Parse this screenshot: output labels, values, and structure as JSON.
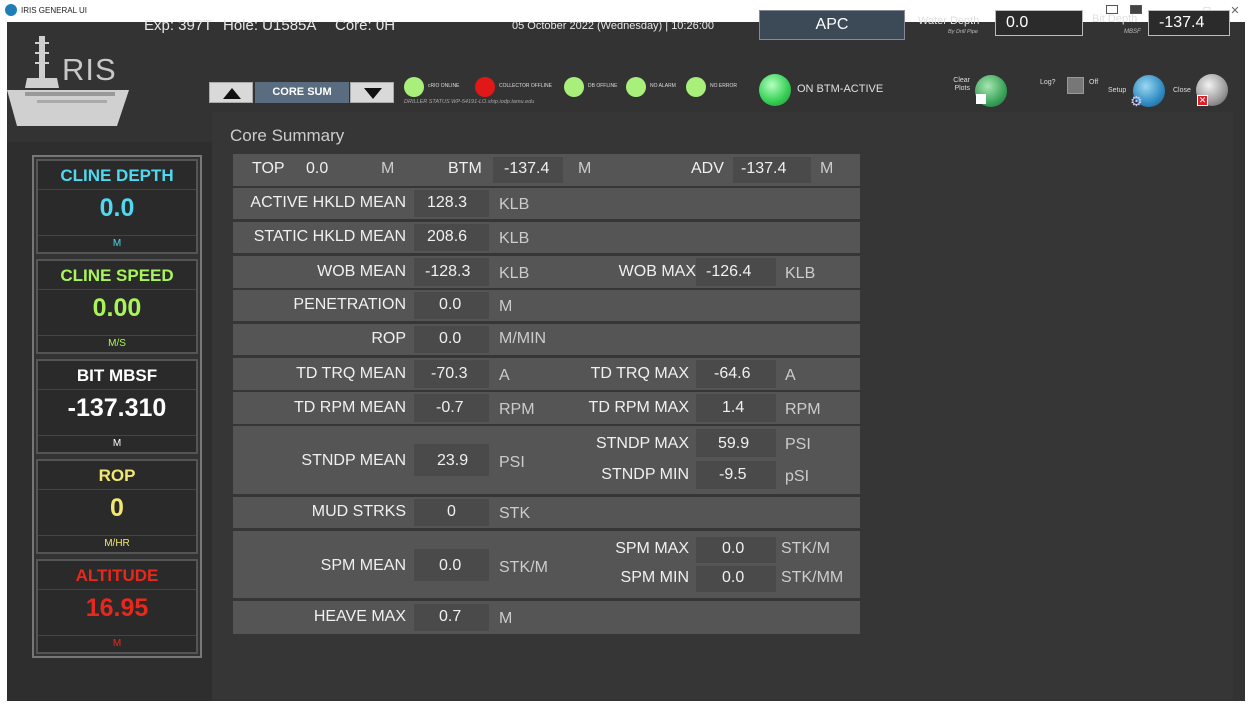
{
  "window": {
    "title": "IRIS GENERAL UI",
    "minimize": "–",
    "maximize": "□",
    "close": "✕"
  },
  "header": {
    "logo": "RIS",
    "exp": "Exp: 397T",
    "hole": "Hole: U1585A",
    "core": "Core: 0H",
    "datetime": "05 October 2022  (Wednesday) | 10:26:00",
    "apc": "APC",
    "core_sum": "CORE SUM",
    "driller_status": "DRILLER STATUS  WP-54191-LO.ship.iodp.tamu.edu",
    "on_btm": "ON BTM-ACTIVE",
    "water_depth_label": "Water Depth",
    "water_depth_sub": "By Drill Pipe",
    "water_depth_value": "0.0",
    "bit_depth_label": "Bit Depth",
    "bit_depth_sub": "MBSF",
    "bit_depth_value": "-137.4",
    "clear_plots": "Clear\nPlots",
    "log_label": "Log?",
    "log_state": "Off",
    "setup": "Setup",
    "close": "Close"
  },
  "status_indicators": [
    {
      "label": "cRIO ONLINE",
      "color": "#a8f07a"
    },
    {
      "label": "COLLECTOR OFFLINE",
      "color": "#e01818"
    },
    {
      "label": "DB OFFLINE",
      "color": "#a8f07a"
    },
    {
      "label": "NO ALARM",
      "color": "#a8f07a"
    },
    {
      "label": "NO ERROR",
      "color": "#a8f07a"
    }
  ],
  "sidebar": [
    {
      "header": "CLINE DEPTH",
      "value": "0.0",
      "unit": "M",
      "color": "#4fd8f0"
    },
    {
      "header": "CLINE SPEED",
      "value": "0.00",
      "unit": "M/S",
      "color": "#a8f55a"
    },
    {
      "header": "BIT MBSF",
      "value": "-137.310",
      "unit": "M",
      "color": "#ffffff"
    },
    {
      "header": "ROP",
      "value": "0",
      "unit": "M/HR",
      "color": "#f2e870"
    },
    {
      "header": "ALTITUDE",
      "value": "16.95",
      "unit": "M",
      "color": "#e8281a"
    }
  ],
  "core_summary": {
    "title": "Core Summary",
    "top": {
      "top_label": "TOP",
      "top_value": "0.0",
      "top_unit": "M",
      "btm_label": "BTM",
      "btm_value": "-137.4",
      "btm_unit": "M",
      "adv_label": "ADV",
      "adv_value": "-137.4",
      "adv_unit": "M"
    },
    "active_hkld": {
      "label": "ACTIVE HKLD MEAN",
      "value": "128.3",
      "unit": "KLB"
    },
    "static_hkld": {
      "label": "STATIC HKLD MEAN",
      "value": "208.6",
      "unit": "KLB"
    },
    "wob": {
      "label": "WOB MEAN",
      "value": "-128.3",
      "unit": "KLB",
      "max_label": "WOB MAX",
      "max_value": "-126.4",
      "max_unit": "KLB"
    },
    "penetration": {
      "label": "PENETRATION",
      "value": "0.0",
      "unit": "M"
    },
    "rop": {
      "label": "ROP",
      "value": "0.0",
      "unit": "M/MIN"
    },
    "td_trq": {
      "label": "TD TRQ MEAN",
      "value": "-70.3",
      "unit": "A",
      "max_label": "TD TRQ MAX",
      "max_value": "-64.6",
      "max_unit": "A"
    },
    "td_rpm": {
      "label": "TD RPM MEAN",
      "value": "-0.7",
      "unit": "RPM",
      "max_label": "TD RPM MAX",
      "max_value": "1.4",
      "max_unit": "RPM"
    },
    "stndp": {
      "label": "STNDP MEAN",
      "value": "23.9",
      "unit": "PSI",
      "max_label": "STNDP MAX",
      "max_value": "59.9",
      "max_unit": "PSI",
      "min_label": "STNDP MIN",
      "min_value": "-9.5",
      "min_unit": "pSI"
    },
    "mud": {
      "label": "MUD STRKS",
      "value": "0",
      "unit": "STK"
    },
    "spm": {
      "label": "SPM MEAN",
      "value": "0.0",
      "unit": "STK/M",
      "max_label": "SPM MAX",
      "max_value": "0.0",
      "max_unit": "STK/M",
      "min_label": "SPM MIN",
      "min_value": "0.0",
      "min_unit": "STK/MM"
    },
    "heave": {
      "label": "HEAVE MAX",
      "value": "0.7",
      "unit": "M"
    }
  }
}
